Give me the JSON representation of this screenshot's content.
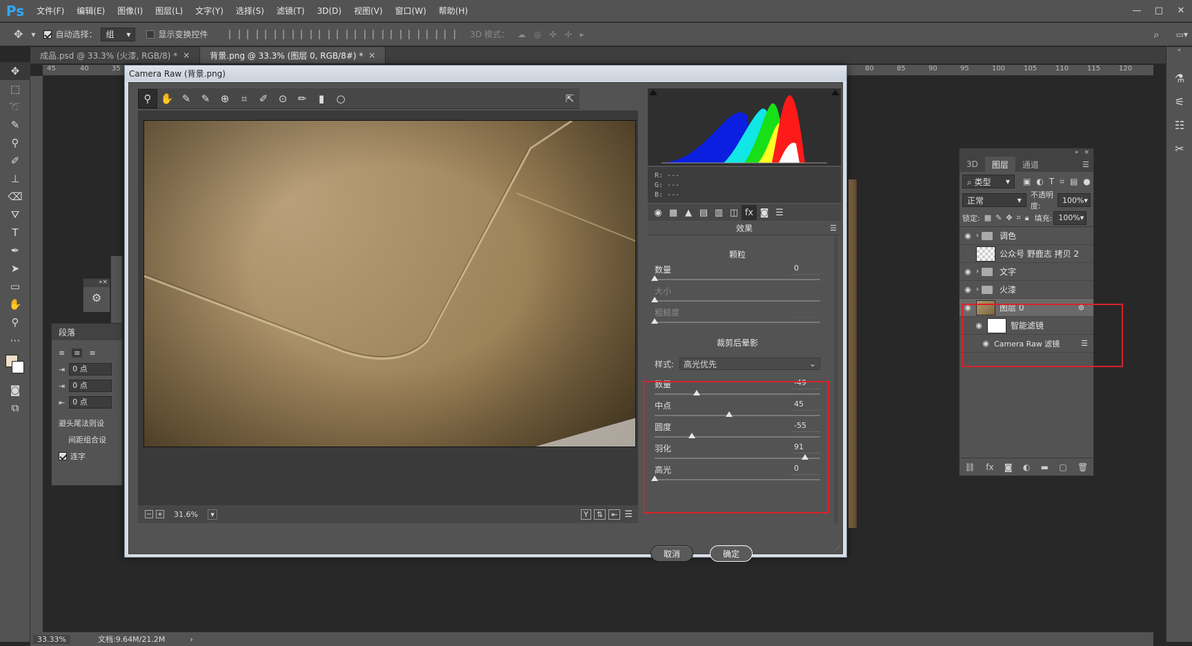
{
  "menubar": {
    "logo": "Ps",
    "items": [
      "文件(F)",
      "编辑(E)",
      "图像(I)",
      "图层(L)",
      "文字(Y)",
      "选择(S)",
      "滤镜(T)",
      "3D(D)",
      "视图(V)",
      "窗口(W)",
      "帮助(H)"
    ],
    "win_min": "—",
    "win_max": "□",
    "win_close": "✕"
  },
  "options": {
    "auto_select_label": "自动选择：",
    "auto_select_value": "组",
    "show_transform_label": "显示变换控件",
    "mode3d_label": "3D 模式："
  },
  "tabs": [
    {
      "label": "成品.psd @ 33.3% (火漆, RGB/8) *",
      "close": "×"
    },
    {
      "label": "背景.png @ 33.3% (图层 0, RGB/8#) *",
      "close": "×"
    }
  ],
  "ruler_top": [
    "45",
    "40",
    "35",
    "80",
    "85",
    "90",
    "95",
    "100",
    "105",
    "110",
    "115",
    "120"
  ],
  "status": {
    "zoom": "33.33%",
    "doc": "文档:9.64M/21.2M",
    "arrow": "›"
  },
  "para_panel": {
    "title": "段落",
    "fields": [
      "0 点",
      "0 点",
      "0 点"
    ],
    "hyphen_label": "避头尾法则设",
    "compose_label": "间距组合设",
    "ligature_label": "连字"
  },
  "dialog": {
    "title": "Camera Raw (背景.png)",
    "zoom": "31.6%",
    "rgb": {
      "r": "R:  ---",
      "g": "G:  ---",
      "b": "B:  ---"
    },
    "panel_title": "效果",
    "grain": {
      "title": "颗粒",
      "amount_label": "数量",
      "amount_value": "0",
      "size_label": "大小",
      "rough_label": "粗糙度"
    },
    "vignette": {
      "title": "裁剪后晕影",
      "style_label": "样式:",
      "style_value": "高光优先",
      "sliders": [
        {
          "label": "数量",
          "value": "-49",
          "pos": 0.255
        },
        {
          "label": "中点",
          "value": "45",
          "pos": 0.45
        },
        {
          "label": "圆度",
          "value": "-55",
          "pos": 0.225
        },
        {
          "label": "羽化",
          "value": "91",
          "pos": 0.91
        },
        {
          "label": "高光",
          "value": "0",
          "pos": 0.0
        }
      ]
    },
    "cancel": "取消",
    "ok": "确定"
  },
  "layers": {
    "tabs": [
      "3D",
      "图层",
      "通道"
    ],
    "filter_label": "类型",
    "blend_mode": "正常",
    "opacity_label": "不透明度:",
    "opacity_value": "100%",
    "lock_label": "锁定:",
    "fill_label": "填充:",
    "fill_value": "100%",
    "items": [
      {
        "name": "调色",
        "kind": "group",
        "visible": true
      },
      {
        "name": "公众号 野鹿志 拷贝 2",
        "kind": "layer",
        "visible": false
      },
      {
        "name": "文字",
        "kind": "group",
        "visible": true
      },
      {
        "name": "火漆",
        "kind": "group",
        "visible": true
      },
      {
        "name": "图层 0",
        "kind": "smart",
        "visible": true
      },
      {
        "name": "智能滤镜",
        "kind": "mask",
        "visible": true
      },
      {
        "name": "Camera Raw 滤镜",
        "kind": "filter",
        "visible": true
      }
    ]
  },
  "colors": {
    "accent": "#31a8ff",
    "highlight_box": "#d9222a"
  }
}
